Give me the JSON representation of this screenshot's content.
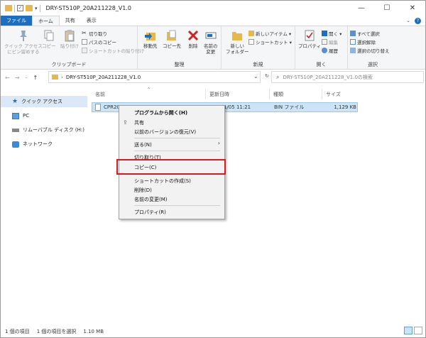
{
  "window": {
    "title": "DRY-ST510P_20A211228_V1.0",
    "minimize": "—",
    "maximize": "☐",
    "close": "✕"
  },
  "tabs": {
    "file": "ファイル",
    "home": "ホーム",
    "share": "共有",
    "view": "表示"
  },
  "ribbon": {
    "clipboard": {
      "label": "クリップボード",
      "pin": "クイック アクセス",
      "pin2": "にピン留めする",
      "copy": "コピー",
      "paste": "貼り付け",
      "cut": "切り取り",
      "copy_path": "パスのコピー",
      "paste_shortcut": "ショートカットの貼り付け"
    },
    "organize": {
      "label": "整理",
      "move_to": "移動先",
      "copy_to": "コピー先",
      "delete": "削除",
      "rename": "名前の",
      "rename2": "変更"
    },
    "new": {
      "label": "新規",
      "new_folder": "新しい",
      "new_folder2": "フォルダー",
      "new_item": "新しいアイテム ▾",
      "shortcut": "ショートカット ▾"
    },
    "open": {
      "label": "開く",
      "properties": "プロパティ",
      "open": "開く ▾",
      "edit": "編集",
      "history": "履歴"
    },
    "select": {
      "label": "選択",
      "all": "すべて選択",
      "none": "選択解除",
      "invert": "選択の切り替え"
    }
  },
  "address": {
    "path": "DRY-ST510P_20A211228_V1.0",
    "search_placeholder": "DRY-ST510P_20A211228_V1.0の検索"
  },
  "nav": {
    "quick_access": "クイック アクセス",
    "pc": "PC",
    "removable": "リムーバブル ディスク (H:)",
    "network": "ネットワーク"
  },
  "columns": {
    "name": "名前",
    "date": "更新日時",
    "type": "種類",
    "size": "サイズ"
  },
  "file": {
    "name": "CPR20",
    "date": "1/05 11:21",
    "type": "BIN ファイル",
    "size": "1,129 KB"
  },
  "context_menu": {
    "open_with": "プログラムから開く(H)",
    "share": "共有",
    "restore": "以前のバージョンの復元(V)",
    "send_to": "送る(N)",
    "cut": "切り取り(T)",
    "copy": "コピー(C)",
    "create_shortcut": "ショートカットの作成(S)",
    "delete": "削除(D)",
    "rename": "名前の変更(M)",
    "properties": "プロパティ(R)"
  },
  "status": {
    "count": "1 個の項目",
    "selected": "1 個の項目を選択",
    "size": "1.10 MB"
  },
  "colors": {
    "accent": "#1a6fc4",
    "selection": "#cce4f7",
    "highlight_box": "#e0181d"
  }
}
